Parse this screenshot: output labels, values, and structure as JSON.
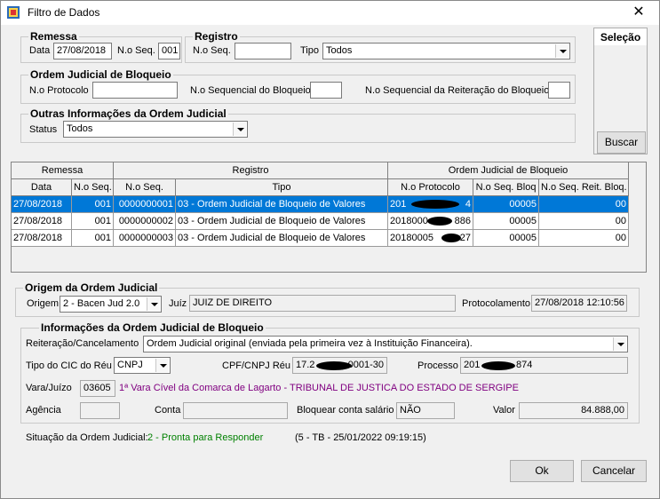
{
  "window": {
    "title": "Filtro de Dados",
    "close_glyph": "✕"
  },
  "remessa": {
    "group_title": "Remessa",
    "data_label": "Data",
    "data_value": "27/08/2018",
    "nseq_label": "N.o Seq.",
    "nseq_value": "001"
  },
  "registro": {
    "group_title": "Registro",
    "nseq_label": "N.o Seq.",
    "nseq_value": "",
    "tipo_label": "Tipo",
    "tipo_value": "Todos"
  },
  "ordem_bloqueio": {
    "group_title": "Ordem Judicial de Bloqueio",
    "protocolo_label": "N.o Protocolo",
    "protocolo_value": "",
    "seq_bloqueio_label": "N.o Sequencial do Bloqueio",
    "seq_bloqueio_value": "",
    "seq_reiteracao_label": "N.o Sequencial da Reiteração do Bloqueio",
    "seq_reiteracao_value": ""
  },
  "outras_info": {
    "group_title": "Outras Informações da Ordem Judicial",
    "status_label": "Status",
    "status_value": "Todos"
  },
  "side": {
    "tab_label": "Seleção",
    "buscar_label": "Buscar"
  },
  "grid": {
    "group_headers": [
      "Remessa",
      "Registro",
      "Ordem Judicial de Bloqueio"
    ],
    "columns": [
      "Data",
      "N.o Seq.",
      "N.o Seq.",
      "Tipo",
      "N.o Protocolo",
      "N.o Seq. Bloq",
      "N.o Seq. Reit. Bloq."
    ],
    "rows": [
      [
        "27/08/2018",
        "001",
        "0000000001",
        "03 - Ordem Judicial de Bloqueio de Valores",
        "201",
        "00005",
        "00"
      ],
      [
        "27/08/2018",
        "001",
        "0000000002",
        "03 - Ordem Judicial de Bloqueio de Valores",
        "2018000",
        "00005",
        "00"
      ],
      [
        "27/08/2018",
        "001",
        "0000000003",
        "03 - Ordem Judicial de Bloqueio de Valores",
        "20180005",
        "00005",
        "00"
      ]
    ],
    "row_suffixes": [
      "4",
      "886",
      "27"
    ]
  },
  "origem": {
    "group_title": "Origem da Ordem Judicial",
    "origem_label": "Origem",
    "origem_value": "2 - Bacen Jud 2.0",
    "juiz_label": "Juíz",
    "juiz_value": "JUIZ DE DIREITO",
    "protocolamento_label": "Protocolamento",
    "protocolamento_value": "27/08/2018 12:10:56"
  },
  "info_bloqueio": {
    "group_title": "Informações da Ordem Judicial de Bloqueio",
    "reiteracao_label": "Reiteração/Cancelamento",
    "reiteracao_value": "Ordem Judicial original (enviada pela primeira vez à Instituição Financeira).",
    "tipo_cic_label": "Tipo do CIC do Réu",
    "tipo_cic_value": "CNPJ",
    "cpf_label": "CPF/CNPJ Réu",
    "cpf_value_prefix": "17.2",
    "cpf_value_suffix": "0001-30",
    "processo_label": "Processo",
    "processo_value_prefix": "201",
    "processo_value_suffix": "874",
    "vara_label": "Vara/Juízo",
    "vara_code": "03605",
    "vara_desc": "1ª Vara Cível da Comarca de Lagarto - TRIBUNAL DE JUSTICA DO ESTADO DE SERGIPE",
    "agencia_label": "Agência",
    "agencia_value": "",
    "conta_label": "Conta",
    "conta_value": "",
    "bloquear_label": "Bloquear conta salário",
    "bloquear_value": "NÃO",
    "valor_label": "Valor",
    "valor_value": "84.888,00"
  },
  "situacao": {
    "label": "Situação da Ordem Judicial:",
    "value": "2 - Pronta para Responder",
    "extra": "(5 - TB - 25/01/2022 09:19:15)"
  },
  "buttons": {
    "ok": "Ok",
    "cancel": "Cancelar"
  }
}
